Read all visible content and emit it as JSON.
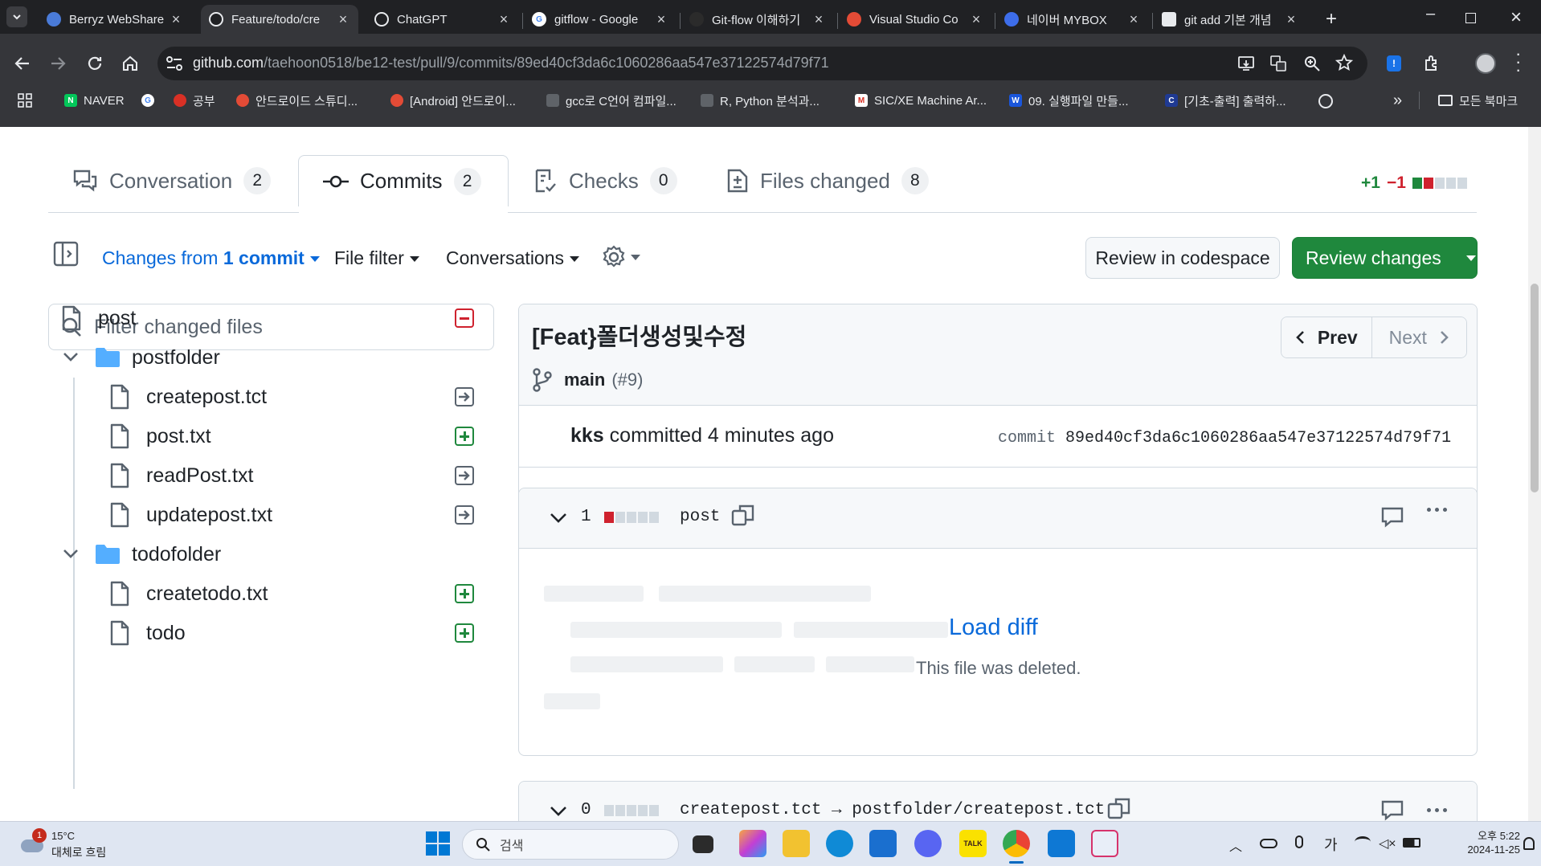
{
  "browser": {
    "tabs": [
      {
        "title": "Berryz WebShare",
        "active": false
      },
      {
        "title": "Feature/todo/cre",
        "active": true
      },
      {
        "title": "ChatGPT",
        "active": false
      },
      {
        "title": "gitflow - Google",
        "active": false
      },
      {
        "title": "Git-flow 이해하기",
        "active": false
      },
      {
        "title": "Visual Studio Co",
        "active": false
      },
      {
        "title": "네이버 MYBOX",
        "active": false
      },
      {
        "title": "git add 기본 개념",
        "active": false
      }
    ],
    "url_host": "github.com",
    "url_path": "/taehoon0518/be12-test/pull/9/commits/89ed40cf3da6c1060286aa547e37122574d79f71",
    "bookmarks": [
      {
        "label": "NAVER"
      },
      {
        "label": ""
      },
      {
        "label": "공부"
      },
      {
        "label": "안드로이드 스튜디..."
      },
      {
        "label": "[Android] 안드로이..."
      },
      {
        "label": "gcc로 C언어 컴파일..."
      },
      {
        "label": "R, Python 분석과..."
      },
      {
        "label": "SIC/XE Machine Ar..."
      },
      {
        "label": "09. 실행파일 만들..."
      },
      {
        "label": "[기초-출력] 출력하..."
      }
    ],
    "all_bookmarks_label": "모든 북마크",
    "more_bookmarks": "»"
  },
  "pr": {
    "tabs": [
      {
        "label": "Conversation",
        "count": "2"
      },
      {
        "label": "Commits",
        "count": "2"
      },
      {
        "label": "Checks",
        "count": "0"
      },
      {
        "label": "Files changed",
        "count": "8"
      }
    ],
    "diffstat_add": "+1",
    "diffstat_del": "−1",
    "changes_from": "Changes from",
    "changes_commit": "1 commit",
    "file_filter": "File filter",
    "conversations": "Conversations",
    "review_codespace": "Review in codespace",
    "review_changes": "Review changes",
    "filter_placeholder": "Filter changed files",
    "tree": [
      {
        "name": "post",
        "type": "file",
        "status": "deleted"
      },
      {
        "name": "postfolder",
        "type": "folder"
      },
      {
        "name": "createpost.tct",
        "type": "file",
        "status": "renamed"
      },
      {
        "name": "post.txt",
        "type": "file",
        "status": "added"
      },
      {
        "name": "readPost.txt",
        "type": "file",
        "status": "renamed"
      },
      {
        "name": "updatepost.txt",
        "type": "file",
        "status": "renamed"
      },
      {
        "name": "todofolder",
        "type": "folder"
      },
      {
        "name": "createtodo.txt",
        "type": "file",
        "status": "added"
      },
      {
        "name": "todo",
        "type": "file",
        "status": "added"
      }
    ],
    "commit": {
      "title": "[Feat}폴더생성및수정",
      "prev": "Prev",
      "next": "Next",
      "branch": "main",
      "pr_ref": "(#9)",
      "author": "kks",
      "committed": "committed 4 minutes ago",
      "sha_label": "commit",
      "sha": "89ed40cf3da6c1060286aa547e37122574d79f71"
    },
    "diffs": [
      {
        "count": "1",
        "filename": "post",
        "load_diff": "Load diff",
        "note": "This file was deleted."
      },
      {
        "count": "0",
        "filename": "createpost.tct → postfolder/createpost.tct"
      }
    ]
  },
  "taskbar": {
    "weather_temp": "15°C",
    "weather_desc": "대체로 흐림",
    "weather_badge": "1",
    "search_label": "검색",
    "ime": "가",
    "time": "오후 5:22",
    "date": "2024-11-25"
  },
  "colors": {
    "green": "#1f883d",
    "red": "#cf222e",
    "blue": "#0969da",
    "folder": "#54aeff"
  }
}
